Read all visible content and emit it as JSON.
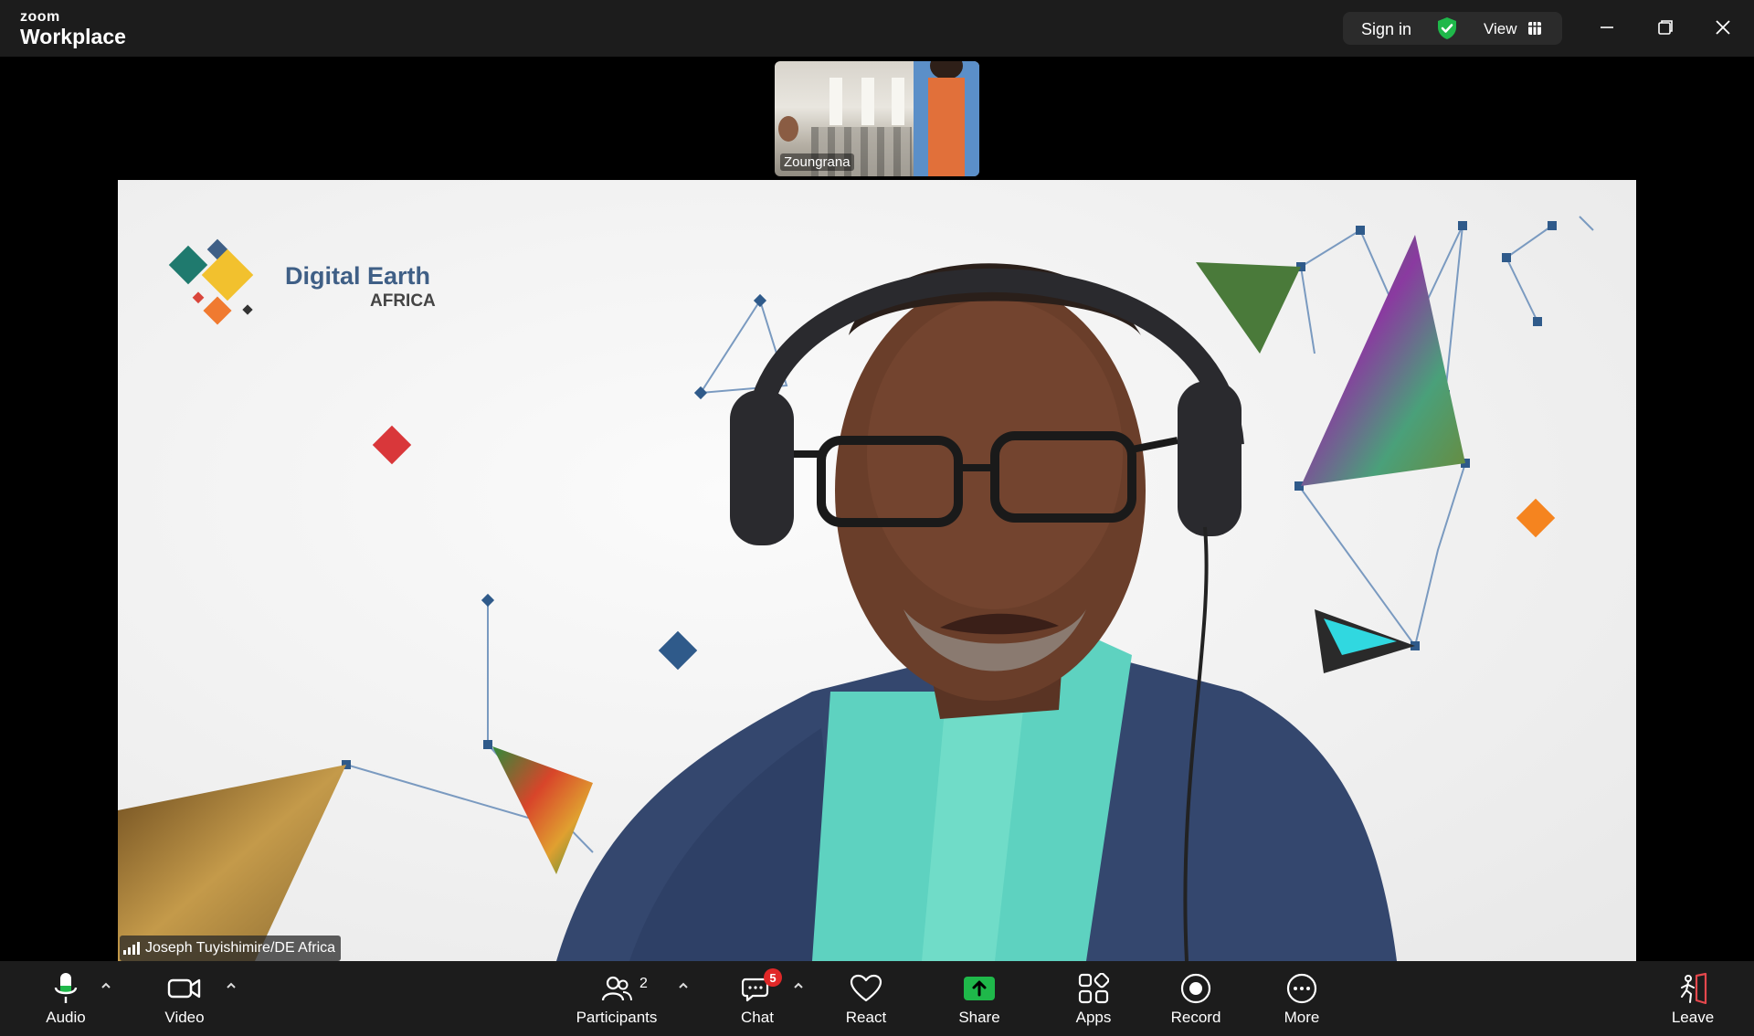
{
  "app": {
    "brand_small": "zoom",
    "brand_big": "Workplace"
  },
  "titlebar": {
    "sign_in": "Sign in",
    "view": "View"
  },
  "thumbnail": {
    "name": "Zoungrana"
  },
  "main_video": {
    "logo_line1": "Digital Earth",
    "logo_line2": "AFRICA",
    "speaker": "Joseph Tuyishimire/DE Africa"
  },
  "toolbar": {
    "audio": "Audio",
    "video": "Video",
    "participants": "Participants",
    "participants_count": "2",
    "chat": "Chat",
    "chat_badge": "5",
    "react": "React",
    "share": "Share",
    "apps": "Apps",
    "record": "Record",
    "more": "More",
    "leave": "Leave"
  },
  "colors": {
    "accent_green": "#1fb84a",
    "badge_red": "#e02828",
    "leave_red": "#e5484d",
    "logo_blue": "#3f5f86"
  }
}
